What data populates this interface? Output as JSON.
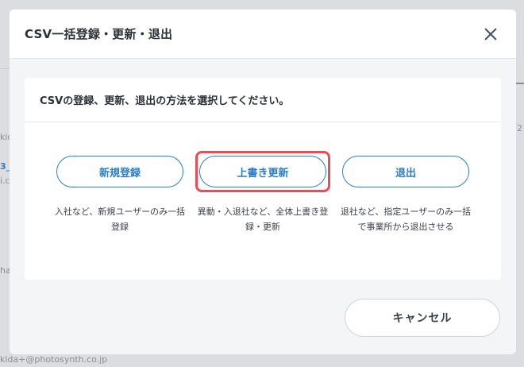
{
  "background": {
    "fragments": [
      "2",
      "kid",
      "3_",
      "i.c",
      "ha"
    ],
    "email": "kida+@photosynth.co.jp"
  },
  "modal": {
    "title": "CSV一括登録・更新・退出",
    "close_icon": "close-icon",
    "prompt": "CSVの登録、更新、退出の方法を選択してください。",
    "options": [
      {
        "label": "新規登録",
        "description": "入社など、新規ユーザーのみ一括登録",
        "highlighted": false
      },
      {
        "label": "上書き更新",
        "description": "異動・入退社など、全体上書き登録・更新",
        "highlighted": true
      },
      {
        "label": "退出",
        "description": "退社など、指定ユーザーのみ一括で事業所から退出させる",
        "highlighted": false
      }
    ],
    "cancel_label": "キャンセル"
  },
  "colors": {
    "accent": "#2b7ec7",
    "highlight": "#ee4b55"
  }
}
